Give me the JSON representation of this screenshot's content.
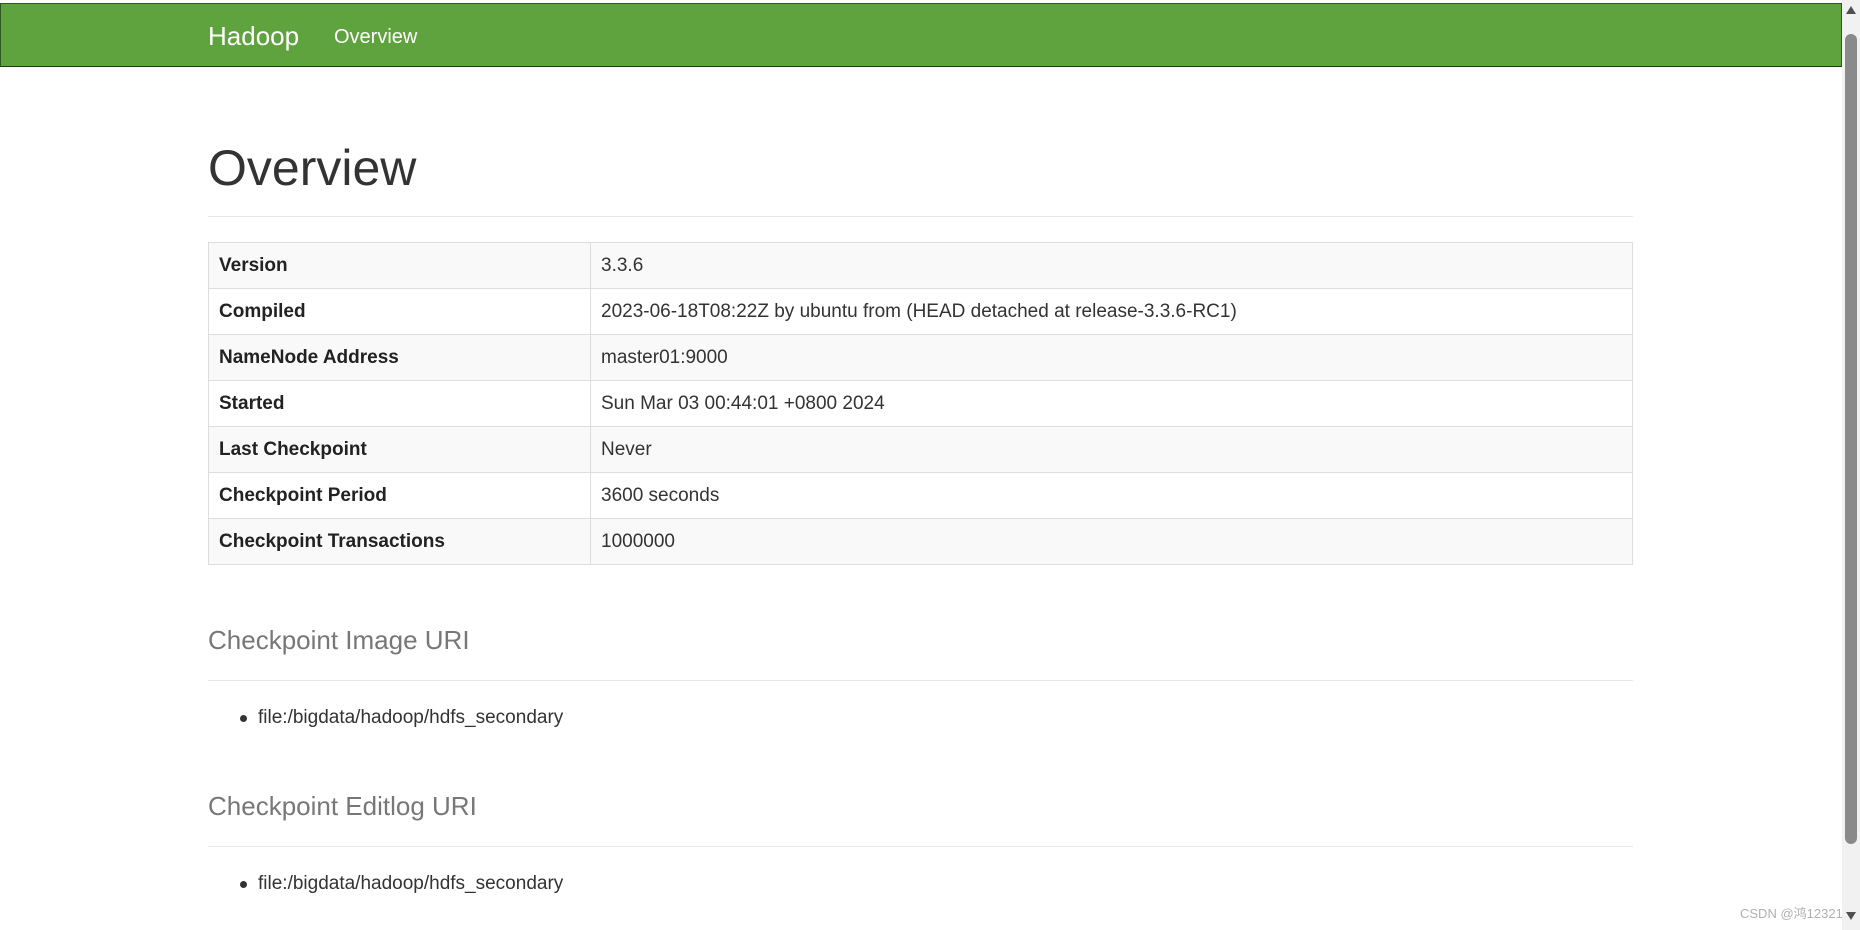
{
  "navbar": {
    "brand": "Hadoop",
    "links": [
      {
        "label": "Overview"
      }
    ]
  },
  "main": {
    "title": "Overview",
    "info_rows": [
      {
        "key": "Version",
        "value": "3.3.6"
      },
      {
        "key": "Compiled",
        "value": "2023-06-18T08:22Z by ubuntu from (HEAD detached at release-3.3.6-RC1)"
      },
      {
        "key": "NameNode Address",
        "value": "master01:9000"
      },
      {
        "key": "Started",
        "value": "Sun Mar 03 00:44:01 +0800 2024"
      },
      {
        "key": "Last Checkpoint",
        "value": "Never"
      },
      {
        "key": "Checkpoint Period",
        "value": "3600 seconds"
      },
      {
        "key": "Checkpoint Transactions",
        "value": "1000000"
      }
    ],
    "image_uri_section": {
      "title": "Checkpoint Image URI",
      "items": [
        "file:/bigdata/hadoop/hdfs_secondary"
      ]
    },
    "editlog_uri_section": {
      "title": "Checkpoint Editlog URI",
      "items": [
        "file:/bigdata/hadoop/hdfs_secondary"
      ]
    }
  },
  "watermark": "CSDN @鸿12321",
  "colors": {
    "navbar_bg": "#5fa33e",
    "section_title": "#777777",
    "text": "#333333"
  }
}
